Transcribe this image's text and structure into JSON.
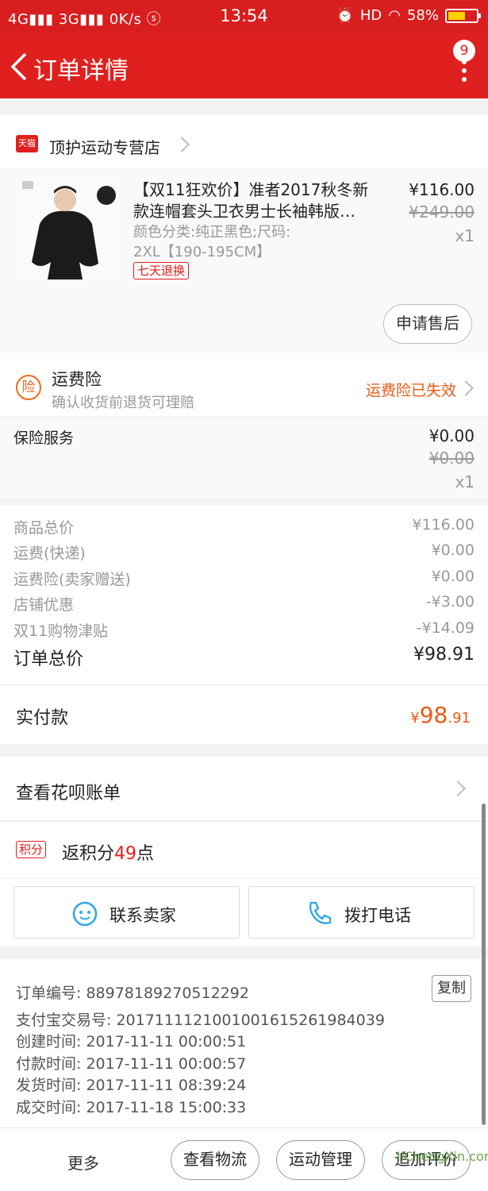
{
  "status": {
    "left": "4G",
    "left2": "3G",
    "speed": "0K/s",
    "time": "13:54",
    "hd": "HD",
    "battery": "58%"
  },
  "header": {
    "title": "订单详情",
    "badge": "9"
  },
  "shop": {
    "badge": "天猫",
    "name": "顶护运动专营店"
  },
  "product": {
    "title": "【双11狂欢价】准者2017秋冬新款连帽套头卫衣男士长袖韩版…",
    "spec_line1": "颜色分类:纯正黑色;尺码:",
    "spec_line2": "2XL【190-195CM】",
    "tag": "七天退换",
    "price": "¥116.00",
    "original_price": "¥249.00",
    "qty": "x1",
    "aftersale": "申请售后"
  },
  "freight_ins": {
    "icon": "险",
    "title": "运费险",
    "subtitle": "确认收货前退货可理赔",
    "status": "运费险已失效"
  },
  "insurance": {
    "label": "保险服务",
    "price": "¥0.00",
    "original_price": "¥0.00",
    "qty": "x1"
  },
  "summary": [
    {
      "label": "商品总价",
      "value": "¥116.00"
    },
    {
      "label": "运费(快递)",
      "value": "¥0.00"
    },
    {
      "label": "运费险(卖家赠送)",
      "value": "¥0.00"
    },
    {
      "label": "店铺优惠",
      "value": "-¥3.00"
    },
    {
      "label": "双11购物津贴",
      "value": "-¥14.09"
    }
  ],
  "order_total": {
    "label": "订单总价",
    "value": "¥98.91"
  },
  "paid": {
    "label": "实付款",
    "currency": "¥",
    "int": "98",
    "dec": ".91"
  },
  "huabei": {
    "label": "查看花呗账单"
  },
  "points": {
    "badge": "积分",
    "prefix": "返积分",
    "num": "49",
    "suffix": "点"
  },
  "contact": {
    "seller": "联系卖家",
    "phone": "拨打电话"
  },
  "order_info": {
    "order_no": "订单编号: 88978189270512292",
    "copy": "复制",
    "alipay_no": "支付宝交易号: 2017111121001001615261984039",
    "created": "创建时间: 2017-11-11 00:00:51",
    "paid": "付款时间: 2017-11-11 00:00:57",
    "shipped": "发货时间: 2017-11-11 08:39:24",
    "completed": "成交时间: 2017-11-18 15:00:33"
  },
  "bottom": {
    "more": "更多",
    "logistics": "查看物流",
    "sport": "运动管理",
    "review": "追加评价"
  },
  "watermark": "JiChengXin.com",
  "colors": {
    "brand_red": "#e0201e",
    "orange": "#ea5a14",
    "link_blue": "#2aa8e4"
  }
}
